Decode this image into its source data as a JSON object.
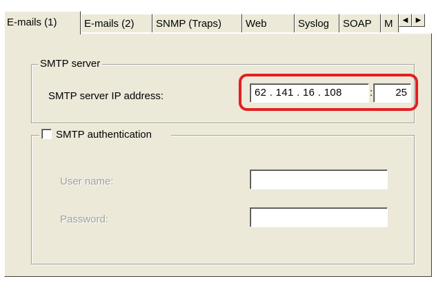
{
  "tabs": [
    {
      "label": "E-mails (1)",
      "active": true
    },
    {
      "label": "E-mails (2)"
    },
    {
      "label": "SNMP (Traps)"
    },
    {
      "label": "Web"
    },
    {
      "label": "Syslog"
    },
    {
      "label": "SOAP"
    },
    {
      "label": "M"
    }
  ],
  "tab_scroll": {
    "left_icon": "triangle-left-icon",
    "right_icon": "triangle-right-icon",
    "left_glyph": "◀",
    "right_glyph": "▶"
  },
  "smtp_server": {
    "group_title": "SMTP server",
    "ip_label": "SMTP server IP address:",
    "ip_value": "62 . 141 . 16 . 108",
    "separator": ":",
    "port_value": "25",
    "highlight_color": "#e51f1f"
  },
  "smtp_auth": {
    "checkbox_label": "SMTP authentication",
    "checked": false,
    "username_label": "User name:",
    "username_value": "",
    "password_label": "Password:",
    "password_value": ""
  },
  "colors": {
    "dialog_face": "#ece9d8",
    "disabled_text": "#a0a0a0"
  }
}
